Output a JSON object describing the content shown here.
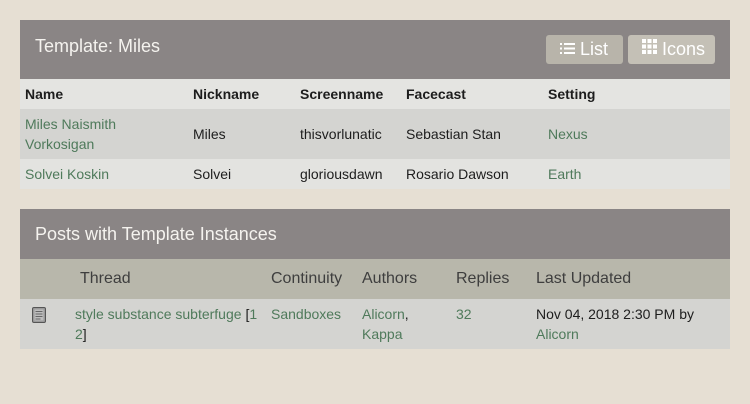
{
  "template": {
    "title": "Template: Miles",
    "list_label": "List",
    "icons_label": "Icons",
    "columns": [
      "Name",
      "Nickname",
      "Screenname",
      "Facecast",
      "Setting"
    ],
    "rows": [
      {
        "name": "Miles Naismith Vorkosigan",
        "nickname": "Miles",
        "screenname": "thisvorlunatic",
        "facecast": "Sebastian Stan",
        "setting": "Nexus"
      },
      {
        "name": "Solvei Koskin",
        "nickname": "Solvei",
        "screenname": "gloriousdawn",
        "facecast": "Rosario Dawson",
        "setting": "Earth"
      }
    ]
  },
  "posts": {
    "title": "Posts with Template Instances",
    "columns": [
      "Thread",
      "Continuity",
      "Authors",
      "Replies",
      "Last Updated"
    ],
    "rows": [
      {
        "thread": "style substance subterfuge",
        "page_open": "[",
        "page1": "1",
        "page2": "2",
        "page_close": "]",
        "continuity": "Sandboxes",
        "author1": "Alicorn",
        "author_sep": ",",
        "author2": "Kappa",
        "replies": "32",
        "updated": "Nov 04, 2018 2:30 PM",
        "updated_by": "by",
        "updated_user": "Alicorn"
      }
    ]
  },
  "colors": {
    "header": "#8a8585",
    "link": "#4f7a5b",
    "background": "#e6dfd3"
  }
}
